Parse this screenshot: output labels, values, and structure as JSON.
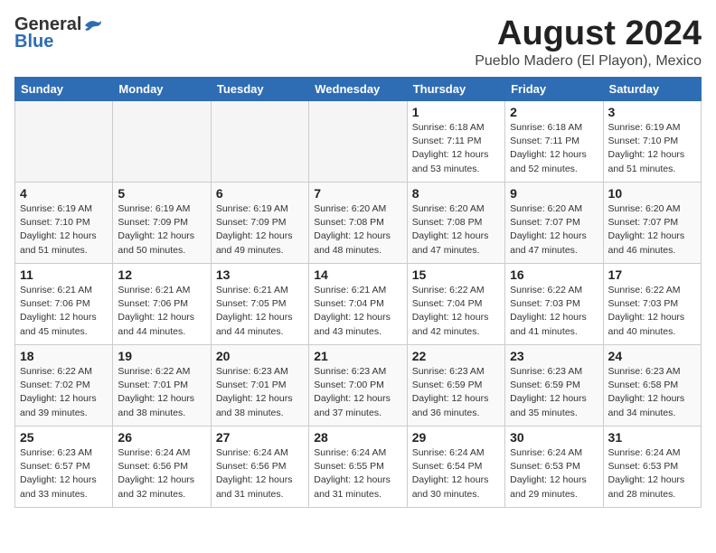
{
  "header": {
    "logo_general": "General",
    "logo_blue": "Blue",
    "month_title": "August 2024",
    "location": "Pueblo Madero (El Playon), Mexico"
  },
  "days_of_week": [
    "Sunday",
    "Monday",
    "Tuesday",
    "Wednesday",
    "Thursday",
    "Friday",
    "Saturday"
  ],
  "weeks": [
    [
      {
        "day": "",
        "empty": true
      },
      {
        "day": "",
        "empty": true
      },
      {
        "day": "",
        "empty": true
      },
      {
        "day": "",
        "empty": true
      },
      {
        "day": "1",
        "sunrise": "6:18 AM",
        "sunset": "7:11 PM",
        "daylight": "12 hours and 53 minutes."
      },
      {
        "day": "2",
        "sunrise": "6:18 AM",
        "sunset": "7:11 PM",
        "daylight": "12 hours and 52 minutes."
      },
      {
        "day": "3",
        "sunrise": "6:19 AM",
        "sunset": "7:10 PM",
        "daylight": "12 hours and 51 minutes."
      }
    ],
    [
      {
        "day": "4",
        "sunrise": "6:19 AM",
        "sunset": "7:10 PM",
        "daylight": "12 hours and 51 minutes."
      },
      {
        "day": "5",
        "sunrise": "6:19 AM",
        "sunset": "7:09 PM",
        "daylight": "12 hours and 50 minutes."
      },
      {
        "day": "6",
        "sunrise": "6:19 AM",
        "sunset": "7:09 PM",
        "daylight": "12 hours and 49 minutes."
      },
      {
        "day": "7",
        "sunrise": "6:20 AM",
        "sunset": "7:08 PM",
        "daylight": "12 hours and 48 minutes."
      },
      {
        "day": "8",
        "sunrise": "6:20 AM",
        "sunset": "7:08 PM",
        "daylight": "12 hours and 47 minutes."
      },
      {
        "day": "9",
        "sunrise": "6:20 AM",
        "sunset": "7:07 PM",
        "daylight": "12 hours and 47 minutes."
      },
      {
        "day": "10",
        "sunrise": "6:20 AM",
        "sunset": "7:07 PM",
        "daylight": "12 hours and 46 minutes."
      }
    ],
    [
      {
        "day": "11",
        "sunrise": "6:21 AM",
        "sunset": "7:06 PM",
        "daylight": "12 hours and 45 minutes."
      },
      {
        "day": "12",
        "sunrise": "6:21 AM",
        "sunset": "7:06 PM",
        "daylight": "12 hours and 44 minutes."
      },
      {
        "day": "13",
        "sunrise": "6:21 AM",
        "sunset": "7:05 PM",
        "daylight": "12 hours and 44 minutes."
      },
      {
        "day": "14",
        "sunrise": "6:21 AM",
        "sunset": "7:04 PM",
        "daylight": "12 hours and 43 minutes."
      },
      {
        "day": "15",
        "sunrise": "6:22 AM",
        "sunset": "7:04 PM",
        "daylight": "12 hours and 42 minutes."
      },
      {
        "day": "16",
        "sunrise": "6:22 AM",
        "sunset": "7:03 PM",
        "daylight": "12 hours and 41 minutes."
      },
      {
        "day": "17",
        "sunrise": "6:22 AM",
        "sunset": "7:03 PM",
        "daylight": "12 hours and 40 minutes."
      }
    ],
    [
      {
        "day": "18",
        "sunrise": "6:22 AM",
        "sunset": "7:02 PM",
        "daylight": "12 hours and 39 minutes."
      },
      {
        "day": "19",
        "sunrise": "6:22 AM",
        "sunset": "7:01 PM",
        "daylight": "12 hours and 38 minutes."
      },
      {
        "day": "20",
        "sunrise": "6:23 AM",
        "sunset": "7:01 PM",
        "daylight": "12 hours and 38 minutes."
      },
      {
        "day": "21",
        "sunrise": "6:23 AM",
        "sunset": "7:00 PM",
        "daylight": "12 hours and 37 minutes."
      },
      {
        "day": "22",
        "sunrise": "6:23 AM",
        "sunset": "6:59 PM",
        "daylight": "12 hours and 36 minutes."
      },
      {
        "day": "23",
        "sunrise": "6:23 AM",
        "sunset": "6:59 PM",
        "daylight": "12 hours and 35 minutes."
      },
      {
        "day": "24",
        "sunrise": "6:23 AM",
        "sunset": "6:58 PM",
        "daylight": "12 hours and 34 minutes."
      }
    ],
    [
      {
        "day": "25",
        "sunrise": "6:23 AM",
        "sunset": "6:57 PM",
        "daylight": "12 hours and 33 minutes."
      },
      {
        "day": "26",
        "sunrise": "6:24 AM",
        "sunset": "6:56 PM",
        "daylight": "12 hours and 32 minutes."
      },
      {
        "day": "27",
        "sunrise": "6:24 AM",
        "sunset": "6:56 PM",
        "daylight": "12 hours and 31 minutes."
      },
      {
        "day": "28",
        "sunrise": "6:24 AM",
        "sunset": "6:55 PM",
        "daylight": "12 hours and 31 minutes."
      },
      {
        "day": "29",
        "sunrise": "6:24 AM",
        "sunset": "6:54 PM",
        "daylight": "12 hours and 30 minutes."
      },
      {
        "day": "30",
        "sunrise": "6:24 AM",
        "sunset": "6:53 PM",
        "daylight": "12 hours and 29 minutes."
      },
      {
        "day": "31",
        "sunrise": "6:24 AM",
        "sunset": "6:53 PM",
        "daylight": "12 hours and 28 minutes."
      }
    ]
  ]
}
